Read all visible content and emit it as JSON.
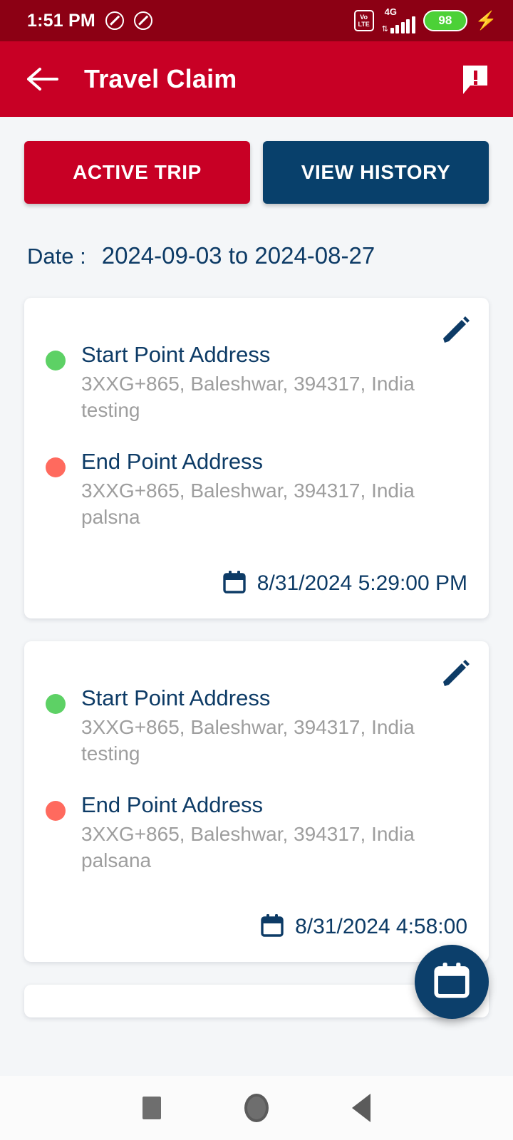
{
  "status_bar": {
    "time": "1:51 PM",
    "icons": [
      "mute-icon",
      "mute-icon"
    ],
    "volte_top": "Vo",
    "volte_bottom": "LTE",
    "network_type": "4G",
    "battery_percent": "98",
    "charging": true
  },
  "app_bar": {
    "back_icon": "back-arrow-icon",
    "title": "Travel Claim",
    "action_icon": "feedback-alert-icon"
  },
  "tabs": [
    {
      "label": "ACTIVE TRIP",
      "active": true,
      "color": "#C80025"
    },
    {
      "label": "VIEW HISTORY",
      "active": false,
      "color": "#08406B"
    }
  ],
  "date_filter": {
    "label": "Date :",
    "value": "2024-09-03 to 2024-08-27"
  },
  "trips": [
    {
      "edit_icon": "pencil-icon",
      "start": {
        "title": "Start Point Address",
        "address": "3XXG+865, Baleshwar, 394317, India testing",
        "dot_color": "#5DD165"
      },
      "end": {
        "title": "End Point Address",
        "address": "3XXG+865, Baleshwar, 394317, India palsna",
        "dot_color": "#FF6A5E"
      },
      "timestamp": "8/31/2024 5:29:00 PM",
      "timestamp_icon": "calendar-icon"
    },
    {
      "edit_icon": "pencil-icon",
      "start": {
        "title": "Start Point Address",
        "address": "3XXG+865, Baleshwar, 394317, India testing",
        "dot_color": "#5DD165"
      },
      "end": {
        "title": "End Point Address",
        "address": "3XXG+865, Baleshwar, 394317, India palsana",
        "dot_color": "#FF6A5E"
      },
      "timestamp": "8/31/2024 4:58:00",
      "timestamp_icon": "calendar-icon"
    },
    {
      "edit_icon": "pencil-icon",
      "partial": true
    }
  ],
  "fab": {
    "icon": "calendar-icon",
    "color": "#0C3F6B"
  },
  "nav_bar": {
    "recents": "recents-square-icon",
    "home": "home-circle-icon",
    "back": "back-triangle-icon"
  },
  "theme": {
    "primary_red": "#C80025",
    "status_red": "#8C0014",
    "navy": "#0D3B66",
    "background": "#F4F6F8",
    "muted_text": "#9E9E9E"
  }
}
